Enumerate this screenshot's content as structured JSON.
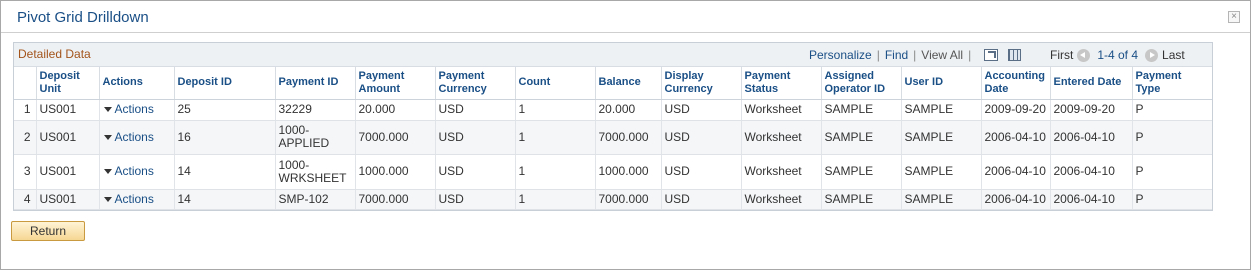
{
  "window": {
    "title": "Pivot Grid Drilldown",
    "close_glyph": "×"
  },
  "grid": {
    "title": "Detailed Data",
    "links": {
      "personalize": "Personalize",
      "find": "Find",
      "view_all": "View All"
    },
    "nav": {
      "first": "First",
      "range": "1-4 of 4",
      "last": "Last"
    },
    "columns": [
      "",
      "Deposit Unit",
      "Actions",
      "Deposit ID",
      "Payment ID",
      "Payment Amount",
      "Payment Currency",
      "Count",
      "Balance",
      "Display Currency",
      "Payment Status",
      "Assigned Operator ID",
      "User ID",
      "Accounting Date",
      "Entered Date",
      "Payment Type"
    ],
    "rows": [
      [
        "1",
        "US001",
        "Actions",
        "25",
        "32229",
        "20.000",
        "USD",
        "1",
        "20.000",
        "USD",
        "Worksheet",
        "SAMPLE",
        "SAMPLE",
        "2009-09-20",
        "2009-09-20",
        "P"
      ],
      [
        "2",
        "US001",
        "Actions",
        "16",
        "1000-APPLIED",
        "7000.000",
        "USD",
        "1",
        "7000.000",
        "USD",
        "Worksheet",
        "SAMPLE",
        "SAMPLE",
        "2006-04-10",
        "2006-04-10",
        "P"
      ],
      [
        "3",
        "US001",
        "Actions",
        "14",
        "1000-WRKSHEET",
        "1000.000",
        "USD",
        "1",
        "1000.000",
        "USD",
        "Worksheet",
        "SAMPLE",
        "SAMPLE",
        "2006-04-10",
        "2006-04-10",
        "P"
      ],
      [
        "4",
        "US001",
        "Actions",
        "14",
        "SMP-102",
        "7000.000",
        "USD",
        "1",
        "7000.000",
        "USD",
        "Worksheet",
        "SAMPLE",
        "SAMPLE",
        "2006-04-10",
        "2006-04-10",
        "P"
      ]
    ]
  },
  "buttons": {
    "return": "Return"
  },
  "colors": {
    "link": "#1a4f86",
    "grid_title": "#a2541b",
    "button_fill": "#f6d793"
  },
  "icons": [
    "close-icon",
    "zoom-icon",
    "download-grid-icon",
    "first-arrow-icon",
    "next-arrow-icon",
    "dropdown-triangle-icon"
  ]
}
